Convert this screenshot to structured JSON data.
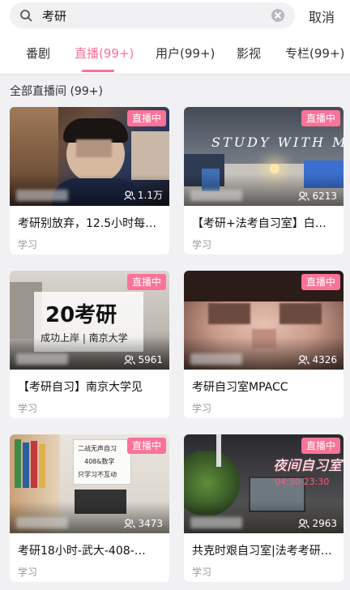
{
  "search": {
    "value": "考研",
    "cancel_label": "取消"
  },
  "tabs": [
    {
      "label": "番剧",
      "active": false
    },
    {
      "label": "直播(99+)",
      "active": true
    },
    {
      "label": "用户(99+)",
      "active": false
    },
    {
      "label": "影视",
      "active": false
    },
    {
      "label": "专栏(99+)",
      "active": false
    }
  ],
  "section": {
    "title": "全部直播间 (99+)"
  },
  "colors": {
    "accent": "#fb7299",
    "tag": "#999999"
  },
  "cards": [
    {
      "badge": "直播中",
      "viewers": "1.1万",
      "title": "考研别放弃，12.5小时每…",
      "tag": "学习"
    },
    {
      "badge": "直播中",
      "viewers": "6213",
      "title": "【考研+法考自习室】白…",
      "tag": "学习",
      "overlay": "STUDY WITH ME"
    },
    {
      "badge": "直播中",
      "viewers": "5961",
      "title": "【考研自习】南京大学见",
      "tag": "学习",
      "overlay_big": "20考研",
      "overlay_small": "成功上岸 | 南京大学"
    },
    {
      "badge": "直播中",
      "viewers": "4326",
      "title": "考研自习室MPACC",
      "tag": "学习"
    },
    {
      "badge": "直播中",
      "viewers": "3473",
      "title": "考研18小时-武大-408-…",
      "tag": "学习",
      "note_lines": [
        "二战无声自习",
        "408&数学",
        "只学习不互动"
      ]
    },
    {
      "badge": "直播中",
      "viewers": "2963",
      "title": "共克时艰自习室|法考考研…",
      "tag": "学习",
      "overlay": "夜间自习室",
      "overlay_time": "04:30-23:30"
    }
  ]
}
